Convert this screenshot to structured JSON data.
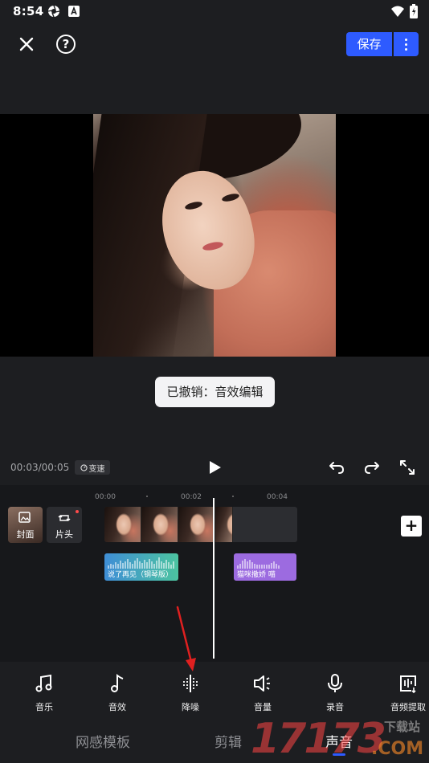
{
  "status_bar": {
    "time": "8:54",
    "left_icons": [
      "aperture-icon",
      "a-badge-icon"
    ],
    "right_icons": [
      "wifi-icon",
      "battery-icon"
    ]
  },
  "top_bar": {
    "save_label": "保存"
  },
  "toast": {
    "text": "已撤销：音效编辑"
  },
  "playback": {
    "time": "00:03/00:05",
    "speed_label": "变速"
  },
  "timeline": {
    "ruler": [
      "00:00",
      "00:02",
      "00:04"
    ],
    "cover_label": "封面",
    "intro_label": "片头",
    "audio_clips": [
      {
        "label": "说了再见（钢琴版）",
        "color": "#3f8ed6"
      },
      {
        "label": "猫咪撒娇 喵",
        "color": "#9c6be0"
      }
    ]
  },
  "toolbar": {
    "items": [
      {
        "label": "音乐",
        "icon": "music-note-icon"
      },
      {
        "label": "音效",
        "icon": "sound-effect-icon"
      },
      {
        "label": "降噪",
        "icon": "noise-reduction-icon"
      },
      {
        "label": "音量",
        "icon": "volume-icon"
      },
      {
        "label": "录音",
        "icon": "microphone-icon"
      },
      {
        "label": "音频提取",
        "icon": "audio-extract-icon"
      }
    ]
  },
  "bottom_tabs": [
    {
      "label": "网感模板",
      "active": false
    },
    {
      "label": "剪辑",
      "active": false
    },
    {
      "label": "声音",
      "active": true
    }
  ],
  "watermark": {
    "digits": "17173",
    "site_cn": "下载站",
    "domain": ".COM"
  },
  "colors": {
    "accent": "#2e5bff",
    "background": "#1d1e21",
    "annotation_arrow": "#e02020"
  }
}
